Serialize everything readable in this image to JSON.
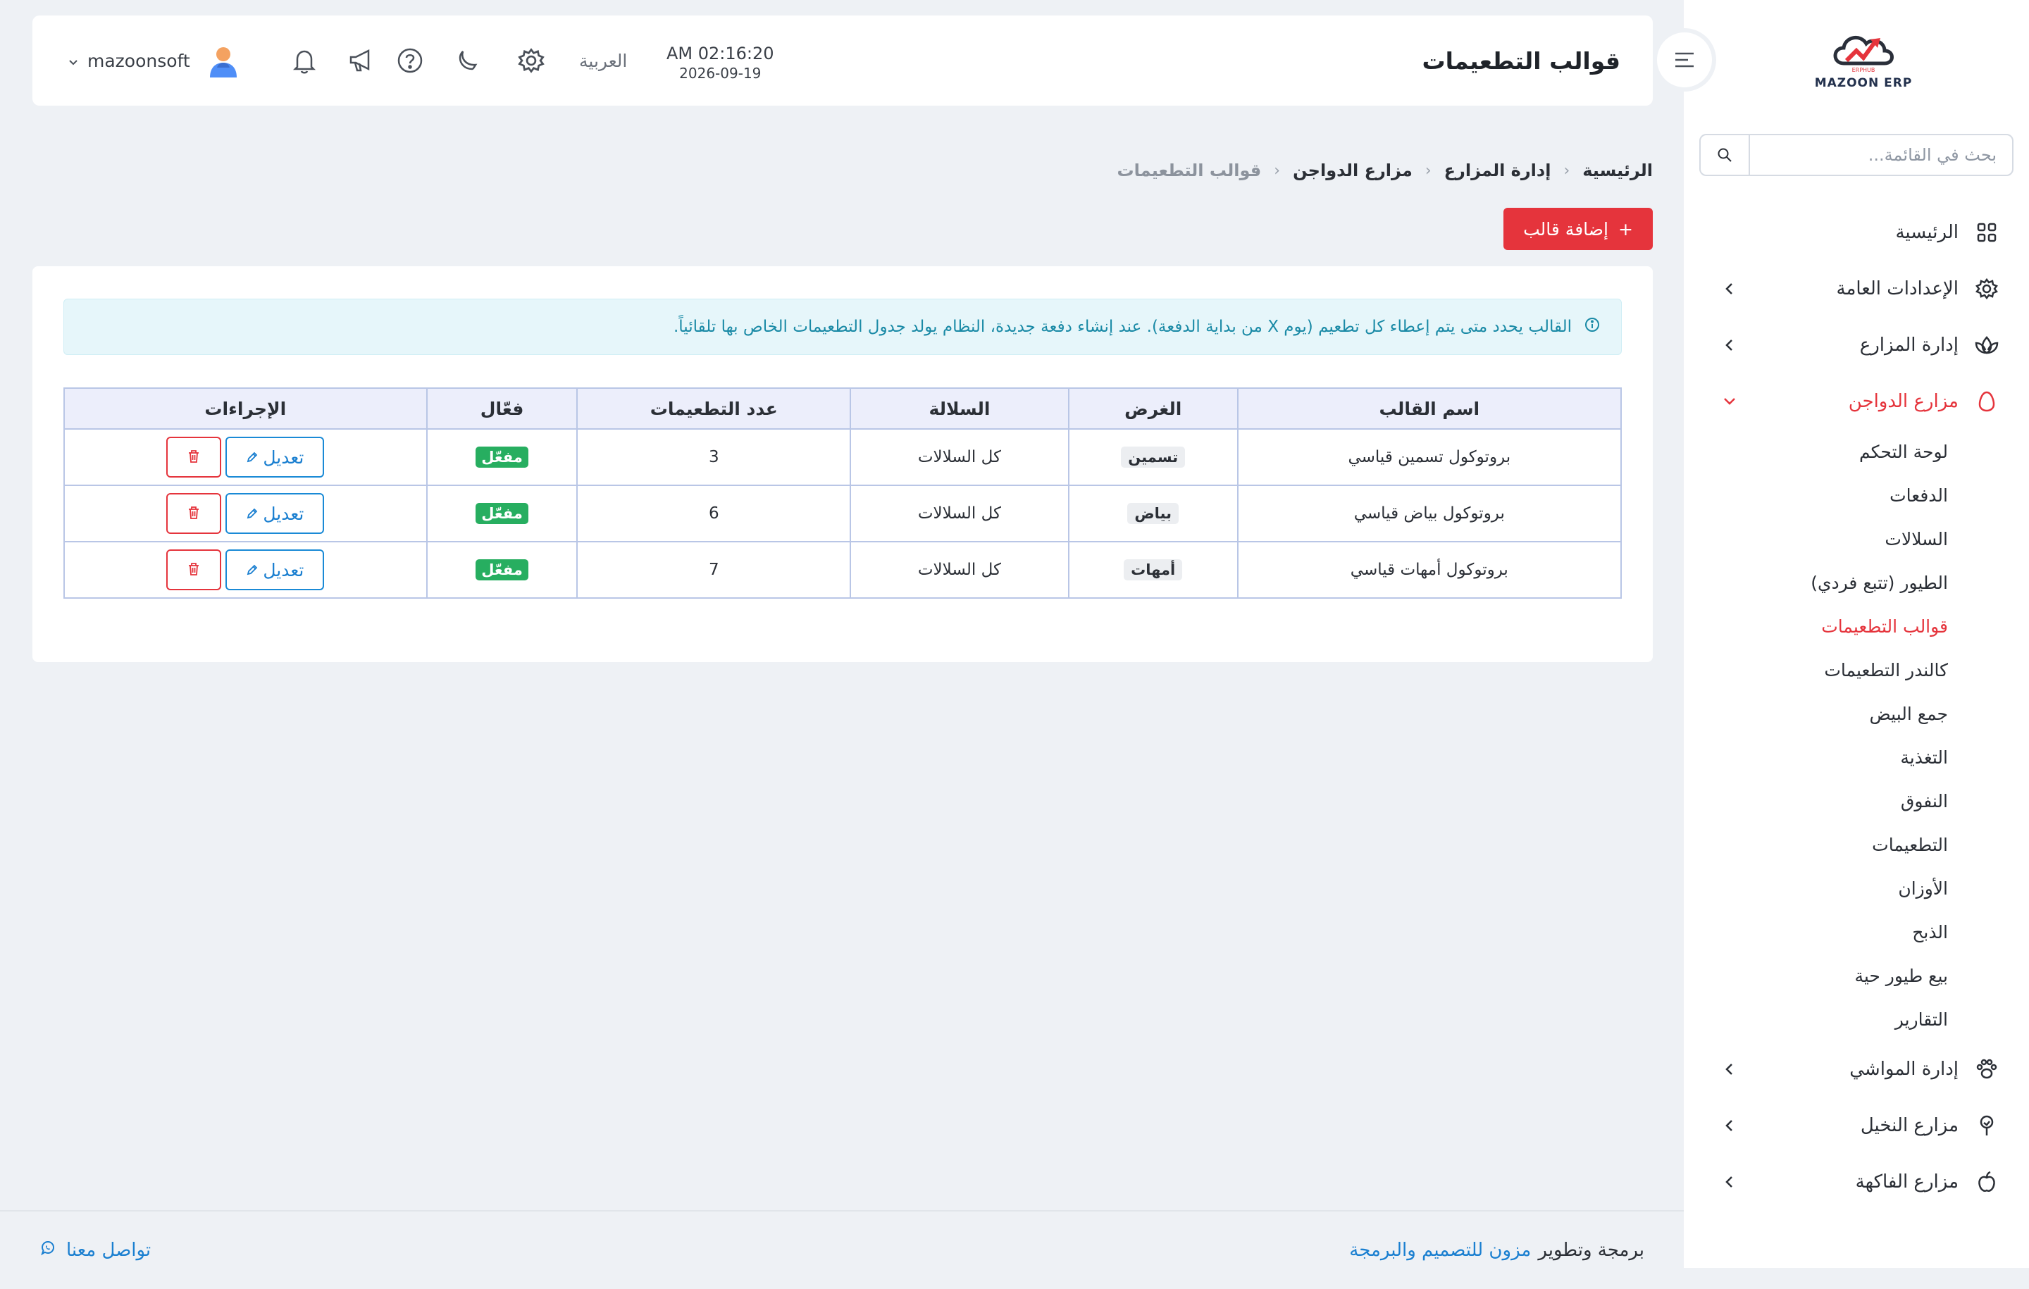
{
  "app": {
    "logo_text": "MAZOON ERP",
    "logo_small_text": "ERPHUB"
  },
  "header": {
    "title": "قوالب التطعيمات",
    "time": "AM 02:16:20",
    "date": "2026-09-19",
    "language": "العربية",
    "username": "mazoonsoft"
  },
  "sidebar": {
    "search_placeholder": "بحث في القائمة...",
    "items": [
      {
        "label": "الرئيسية",
        "icon": "grid-icon"
      },
      {
        "label": "الإعدادات العامة",
        "icon": "gear-icon"
      },
      {
        "label": "إدارة المزارع",
        "icon": "plant-icon"
      },
      {
        "label": "مزارع الدواجن",
        "icon": "egg-icon"
      },
      {
        "label": "إدارة المواشي",
        "icon": "paw-icon"
      },
      {
        "label": "مزارع النخيل",
        "icon": "tree-icon"
      },
      {
        "label": "مزارع الفاكهة",
        "icon": "apple-icon"
      }
    ],
    "poultry_subitems": [
      "لوحة التحكم",
      "الدفعات",
      "السلالات",
      "الطيور (تتبع فردي)",
      "قوالب التطعيمات",
      "كالندر التطعيمات",
      "جمع البيض",
      "التغذية",
      "النفوق",
      "التطعيمات",
      "الأوزان",
      "الذبح",
      "بيع طيور حية",
      "التقارير"
    ]
  },
  "breadcrumb": {
    "items": [
      "الرئيسية",
      "إدارة المزارع",
      "مزارع الدواجن"
    ],
    "current": "قوالب التطعيمات"
  },
  "add_button_label": "إضافة قالب",
  "alert_text": "القالب يحدد متى يتم إعطاء كل تطعيم (يوم X من بداية الدفعة). عند إنشاء دفعة جديدة، النظام يولد جدول التطعيمات الخاص بها تلقائياً.",
  "table": {
    "columns": [
      "اسم القالب",
      "الغرض",
      "السلالة",
      "عدد التطعيمات",
      "فعّال",
      "الإجراءات"
    ],
    "rows": [
      {
        "name": "بروتوكول تسمين قياسي",
        "purpose": "تسمين",
        "breed": "كل السلالات",
        "count": "3",
        "status": "مفعّل"
      },
      {
        "name": "بروتوكول بياض قياسي",
        "purpose": "بياض",
        "breed": "كل السلالات",
        "count": "6",
        "status": "مفعّل"
      },
      {
        "name": "بروتوكول أمهات قياسي",
        "purpose": "أمهات",
        "breed": "كل السلالات",
        "count": "7",
        "status": "مفعّل"
      }
    ],
    "edit_label": "تعديل"
  },
  "footer": {
    "prefix": "برمجة وتطوير",
    "brand": "مزون للتصميم والبرمجة",
    "contact": "تواصل معنا"
  },
  "colors": {
    "accent": "#e5343c",
    "link": "#1a7fd0",
    "success": "#27ae60",
    "info_bg": "#e6f6fa"
  }
}
